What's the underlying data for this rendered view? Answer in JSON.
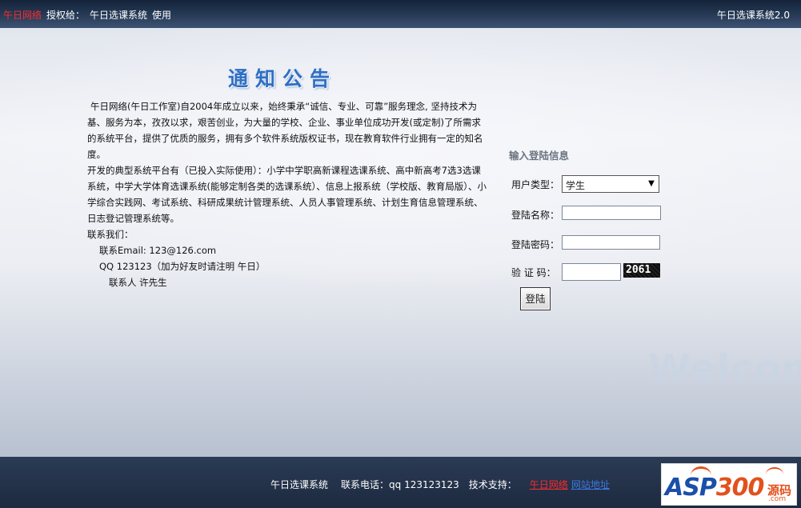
{
  "topbar": {
    "brand": "午日网络",
    "auth_prefix": "授权给：",
    "licensee": "午日选课系统",
    "use": "使用",
    "system_version": "午日选课系统2.0"
  },
  "notice": {
    "title": "通知公告",
    "paragraph1": "午日网络(午日工作室)自2004年成立以来，始终秉承“诚信、专业、可靠”服务理念, 坚持技术为基、服务为本，孜孜以求，艰苦创业，为大量的学校、企业、事业单位成功开发(或定制)了所需求的系统平台，提供了优质的服务，拥有多个软件系统版权证书，现在教育软件行业拥有一定的知名度。",
    "paragraph2": "开发的典型系统平台有（已投入实际使用）：小学中学职高新课程选课系统、高中新高考7选3选课系统，中学大学体育选课系统(能够定制各类的选课系统）、信息上报系统（学校版、教育局版）、小学综合实践网、考试系统、科研成果统计管理系统、人员人事管理系统、计划生育信息管理系统、日志登记管理系统等。",
    "contact_label": "联系我们：",
    "contact_email": "联系Email: 123@126.com",
    "contact_qq": "QQ 123123（加为好友时请注明 午日）",
    "contact_person": "联系人 许先生"
  },
  "login": {
    "title": "输入登陆信息",
    "user_type_label": "用户类型：",
    "user_type_value": "学生",
    "username_label": "登陆名称：",
    "password_label": "登陆密码：",
    "captcha_label": "验 证 码：",
    "captcha_text": "2061",
    "submit_label": "登陆"
  },
  "background_text": "Welcom",
  "footer": {
    "system_name": "午日选课系统",
    "phone": "联系电话：qq 123123123",
    "support_label": "技术支持：",
    "support_brand": "午日网络",
    "site_link": "网站地址"
  },
  "watermark": {
    "asp": "ASP",
    "num": "300",
    "code": "源码",
    "domain": ".com"
  }
}
